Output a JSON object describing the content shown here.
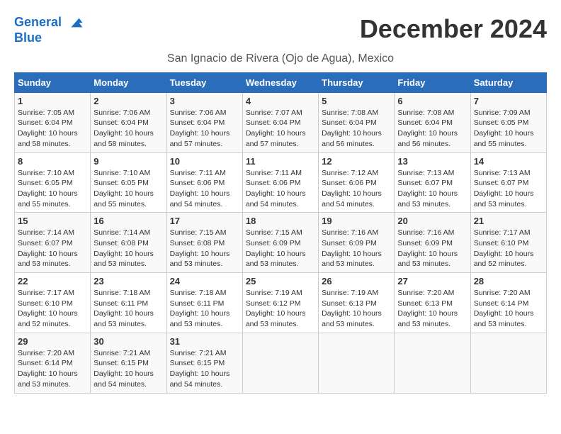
{
  "logo": {
    "line1": "General",
    "line2": "Blue"
  },
  "title": "December 2024",
  "location": "San Ignacio de Rivera (Ojo de Agua), Mexico",
  "days_of_week": [
    "Sunday",
    "Monday",
    "Tuesday",
    "Wednesday",
    "Thursday",
    "Friday",
    "Saturday"
  ],
  "weeks": [
    [
      {
        "day": "1",
        "sunrise": "7:05 AM",
        "sunset": "6:04 PM",
        "daylight": "10 hours and 58 minutes."
      },
      {
        "day": "2",
        "sunrise": "7:06 AM",
        "sunset": "6:04 PM",
        "daylight": "10 hours and 58 minutes."
      },
      {
        "day": "3",
        "sunrise": "7:06 AM",
        "sunset": "6:04 PM",
        "daylight": "10 hours and 57 minutes."
      },
      {
        "day": "4",
        "sunrise": "7:07 AM",
        "sunset": "6:04 PM",
        "daylight": "10 hours and 57 minutes."
      },
      {
        "day": "5",
        "sunrise": "7:08 AM",
        "sunset": "6:04 PM",
        "daylight": "10 hours and 56 minutes."
      },
      {
        "day": "6",
        "sunrise": "7:08 AM",
        "sunset": "6:04 PM",
        "daylight": "10 hours and 56 minutes."
      },
      {
        "day": "7",
        "sunrise": "7:09 AM",
        "sunset": "6:05 PM",
        "daylight": "10 hours and 55 minutes."
      }
    ],
    [
      {
        "day": "8",
        "sunrise": "7:10 AM",
        "sunset": "6:05 PM",
        "daylight": "10 hours and 55 minutes."
      },
      {
        "day": "9",
        "sunrise": "7:10 AM",
        "sunset": "6:05 PM",
        "daylight": "10 hours and 55 minutes."
      },
      {
        "day": "10",
        "sunrise": "7:11 AM",
        "sunset": "6:06 PM",
        "daylight": "10 hours and 54 minutes."
      },
      {
        "day": "11",
        "sunrise": "7:11 AM",
        "sunset": "6:06 PM",
        "daylight": "10 hours and 54 minutes."
      },
      {
        "day": "12",
        "sunrise": "7:12 AM",
        "sunset": "6:06 PM",
        "daylight": "10 hours and 54 minutes."
      },
      {
        "day": "13",
        "sunrise": "7:13 AM",
        "sunset": "6:07 PM",
        "daylight": "10 hours and 53 minutes."
      },
      {
        "day": "14",
        "sunrise": "7:13 AM",
        "sunset": "6:07 PM",
        "daylight": "10 hours and 53 minutes."
      }
    ],
    [
      {
        "day": "15",
        "sunrise": "7:14 AM",
        "sunset": "6:07 PM",
        "daylight": "10 hours and 53 minutes."
      },
      {
        "day": "16",
        "sunrise": "7:14 AM",
        "sunset": "6:08 PM",
        "daylight": "10 hours and 53 minutes."
      },
      {
        "day": "17",
        "sunrise": "7:15 AM",
        "sunset": "6:08 PM",
        "daylight": "10 hours and 53 minutes."
      },
      {
        "day": "18",
        "sunrise": "7:15 AM",
        "sunset": "6:09 PM",
        "daylight": "10 hours and 53 minutes."
      },
      {
        "day": "19",
        "sunrise": "7:16 AM",
        "sunset": "6:09 PM",
        "daylight": "10 hours and 53 minutes."
      },
      {
        "day": "20",
        "sunrise": "7:16 AM",
        "sunset": "6:09 PM",
        "daylight": "10 hours and 53 minutes."
      },
      {
        "day": "21",
        "sunrise": "7:17 AM",
        "sunset": "6:10 PM",
        "daylight": "10 hours and 52 minutes."
      }
    ],
    [
      {
        "day": "22",
        "sunrise": "7:17 AM",
        "sunset": "6:10 PM",
        "daylight": "10 hours and 52 minutes."
      },
      {
        "day": "23",
        "sunrise": "7:18 AM",
        "sunset": "6:11 PM",
        "daylight": "10 hours and 53 minutes."
      },
      {
        "day": "24",
        "sunrise": "7:18 AM",
        "sunset": "6:11 PM",
        "daylight": "10 hours and 53 minutes."
      },
      {
        "day": "25",
        "sunrise": "7:19 AM",
        "sunset": "6:12 PM",
        "daylight": "10 hours and 53 minutes."
      },
      {
        "day": "26",
        "sunrise": "7:19 AM",
        "sunset": "6:13 PM",
        "daylight": "10 hours and 53 minutes."
      },
      {
        "day": "27",
        "sunrise": "7:20 AM",
        "sunset": "6:13 PM",
        "daylight": "10 hours and 53 minutes."
      },
      {
        "day": "28",
        "sunrise": "7:20 AM",
        "sunset": "6:14 PM",
        "daylight": "10 hours and 53 minutes."
      }
    ],
    [
      {
        "day": "29",
        "sunrise": "7:20 AM",
        "sunset": "6:14 PM",
        "daylight": "10 hours and 53 minutes."
      },
      {
        "day": "30",
        "sunrise": "7:21 AM",
        "sunset": "6:15 PM",
        "daylight": "10 hours and 54 minutes."
      },
      {
        "day": "31",
        "sunrise": "7:21 AM",
        "sunset": "6:15 PM",
        "daylight": "10 hours and 54 minutes."
      },
      null,
      null,
      null,
      null
    ]
  ]
}
